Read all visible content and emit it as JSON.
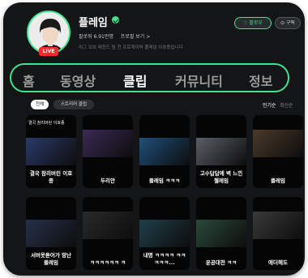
{
  "channel": {
    "name": "플레임",
    "live_badge": "LIVE",
    "followers": "팔로워 6.91만명",
    "profile_link": "프로필 보기 >",
    "description": "리그 오브 레전드 팀 전 프로게이머 플레임 이호종입니다"
  },
  "actions": {
    "follow_label": "팔로우",
    "subscribe_label": "구독"
  },
  "tabs": [
    {
      "label": "홈"
    },
    {
      "label": "동영상"
    },
    {
      "label": "클립",
      "active": true
    },
    {
      "label": "커뮤니티"
    },
    {
      "label": "정보"
    }
  ],
  "filters": {
    "all_label": "전체",
    "streamer_clips_label": "스트리머 클립"
  },
  "sort": {
    "popular_label": "인기순",
    "latest_label": "최신순"
  },
  "clips": [
    {
      "top_caption": "결국 참리버린 이호종",
      "caption": "결국 참리버린 이호종",
      "scene": "#2a3a6a"
    },
    {
      "caption": "두리안",
      "scene": "#3a2a55"
    },
    {
      "caption": "플레임 ㅋㅋㅋ",
      "scene": "#1e4f7a"
    },
    {
      "caption": "고수답답에 벽 느낀 첼레임",
      "scene": "#5a5f66"
    },
    {
      "caption": "플레임",
      "scene": "#4a3a2a"
    },
    {
      "caption": "서버옷듣어가 망난 플레임",
      "scene": "#25304a"
    },
    {
      "caption": "ㅋㅋㅋㅋㅋㅋ ㅋ",
      "scene": "#2a2a2a"
    },
    {
      "caption": "내명 ㅋㅋㅋㅋ ㅋㅋㅋㅋㅋ...",
      "scene": "#1f3f4a"
    },
    {
      "caption": "운공대전 ㅋㅋ",
      "scene": "#2a4a3a"
    },
    {
      "caption": "애더헤도",
      "scene": "#3a3a3a"
    }
  ],
  "colors": {
    "accent": "#3ee58f",
    "live": "#ff2a2a",
    "background": "#141517"
  }
}
